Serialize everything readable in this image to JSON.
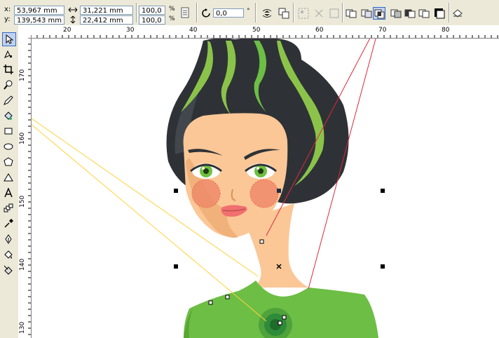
{
  "property_bar": {
    "x_label": "x:",
    "x_value": "53,967 mm",
    "y_label": "y:",
    "y_value": "139,543 mm",
    "width_value": "31,221 mm",
    "height_value": "22,412 mm",
    "scale_x": "100,0",
    "scale_y": "100,0",
    "percent_x": "%",
    "percent_y": "%",
    "rotation_value": "0,0",
    "rotation_unit": "°"
  },
  "rulers": {
    "horizontal_ticks": [
      "20",
      "30",
      "40",
      "50",
      "60",
      "70",
      "80"
    ],
    "vertical_ticks": [
      "170",
      "160",
      "150",
      "140",
      "130"
    ]
  },
  "toolbox": {
    "tools": [
      {
        "name": "pick-tool",
        "icon": "arrow-icon"
      },
      {
        "name": "shape-tool",
        "icon": "shape-edit-icon"
      },
      {
        "name": "crop-tool",
        "icon": "crop-icon"
      },
      {
        "name": "zoom-tool",
        "icon": "magnifier-icon"
      },
      {
        "name": "freehand-tool",
        "icon": "pen-icon"
      },
      {
        "name": "smart-fill-tool",
        "icon": "smart-fill-icon"
      },
      {
        "name": "rectangle-tool",
        "icon": "rectangle-icon"
      },
      {
        "name": "ellipse-tool",
        "icon": "ellipse-icon"
      },
      {
        "name": "polygon-tool",
        "icon": "polygon-icon"
      },
      {
        "name": "basic-shapes-tool",
        "icon": "basic-shapes-icon"
      },
      {
        "name": "text-tool",
        "icon": "text-icon"
      },
      {
        "name": "interactive-blend-tool",
        "icon": "blend-icon"
      },
      {
        "name": "eyedropper-tool",
        "icon": "eyedropper-icon"
      },
      {
        "name": "outline-tool",
        "icon": "outline-pen-icon"
      },
      {
        "name": "fill-tool",
        "icon": "fill-bucket-icon"
      },
      {
        "name": "interactive-fill-tool",
        "icon": "interactive-fill-icon"
      }
    ]
  },
  "colors": {
    "hair": "#2e3236",
    "hair_highlight": "#8bc34a",
    "skin": "#fbc797",
    "skin_shadow": "#f0b27a",
    "eye_iris": "#6fbf3f",
    "blush": "#ef8a6a",
    "lips": "#f06f6f",
    "shirt": "#6dbe45",
    "pendant": "#2e8b3a",
    "callout_yellow": "#ffd23c",
    "callout_red": "#e0283c"
  }
}
